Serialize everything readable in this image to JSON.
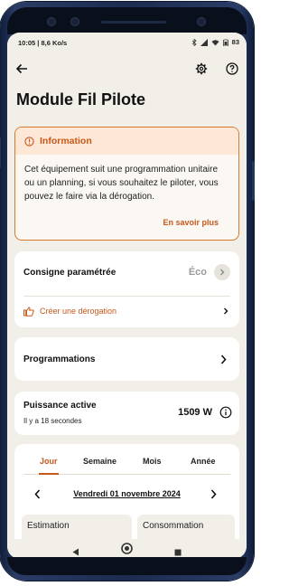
{
  "status_bar": {
    "time_speed": "10:05 | 8,6 Ko/s",
    "battery": "83"
  },
  "header": {
    "back_icon": "arrow-left-icon",
    "settings_icon": "gear-icon",
    "help_icon": "help-circle-icon"
  },
  "page": {
    "title": "Module Fil Pilote"
  },
  "info_card": {
    "heading": "Information",
    "body": "Cet équipement suit une programmation unitaire ou un planning, si vous souhaitez le piloter, vous pouvez le faire via la dérogation.",
    "link": "En savoir plus"
  },
  "consigne": {
    "label": "Consigne paramétrée",
    "value": "Éco",
    "action": "Créer une dérogation"
  },
  "programmations": {
    "label": "Programmations"
  },
  "puissance": {
    "label": "Puissance active",
    "subtitle": "Il y a 18 secondes",
    "value": "1509 W"
  },
  "period_tabs": {
    "tabs": [
      "Jour",
      "Semaine",
      "Mois",
      "Année"
    ],
    "active": "Jour",
    "date": "Vendredi 01 novembre 2024"
  },
  "sub_cards": {
    "estimation": "Estimation",
    "consommation": "Consommation"
  },
  "colors": {
    "accent": "#c8581a",
    "info_bg": "#fde7d6",
    "screen_bg": "#f2efe9"
  }
}
